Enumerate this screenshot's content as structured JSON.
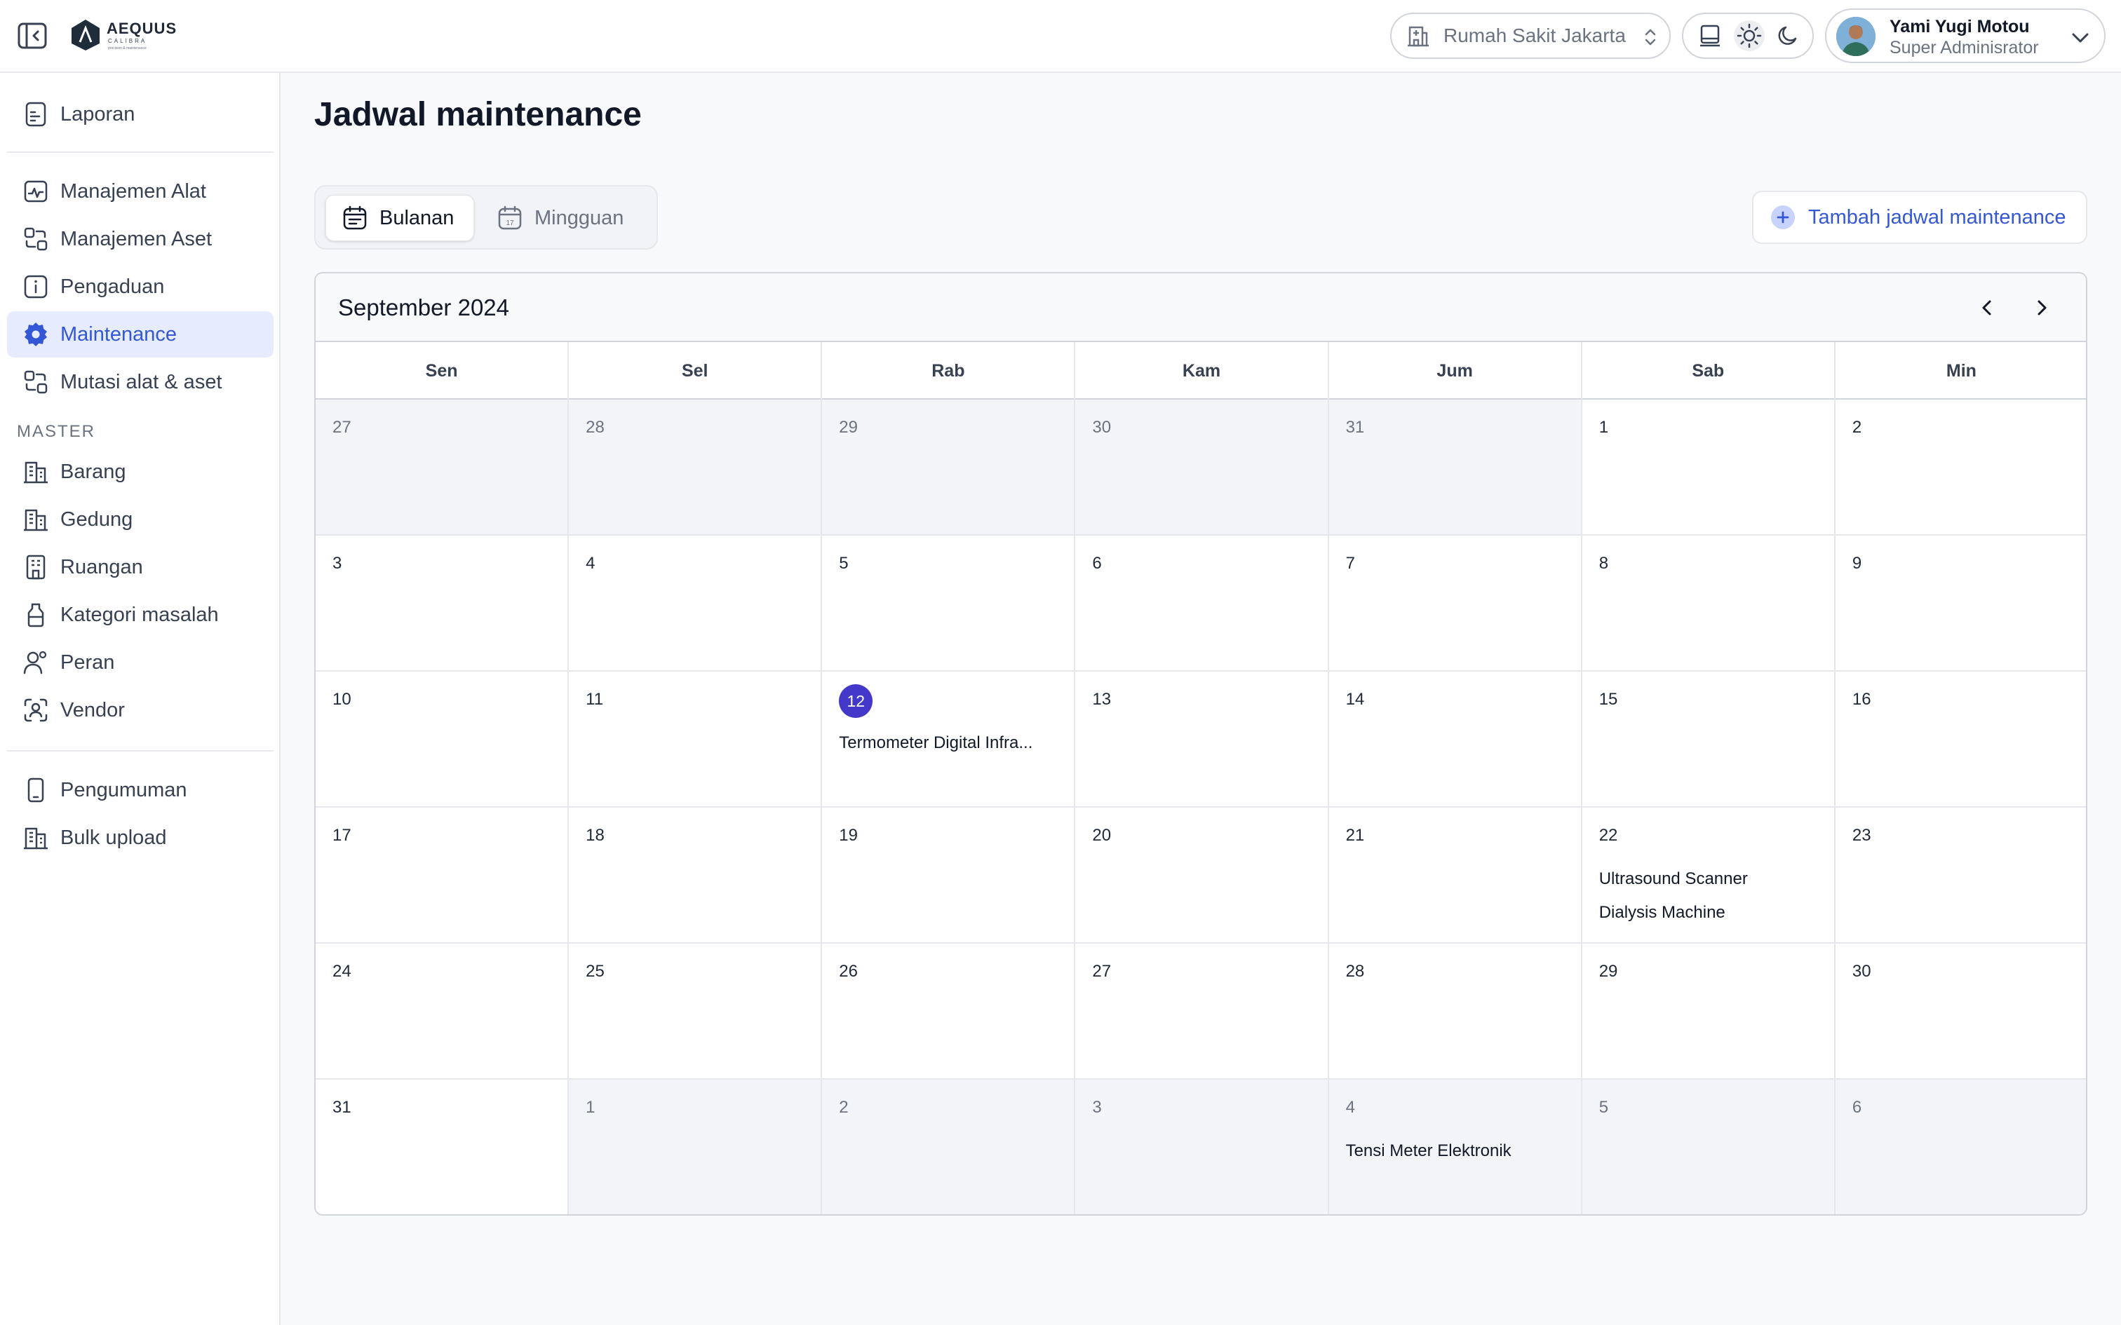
{
  "header": {
    "logo": {
      "name": "AEQUUS",
      "sub": "CALIBRA",
      "tag": "precision & maintenance"
    },
    "hospital_select": {
      "value": "Rumah Sakit Jakarta"
    },
    "user": {
      "name": "Yami Yugi Motou",
      "role": "Super Adminisrator"
    }
  },
  "sidebar": {
    "top_items": [
      {
        "label": "Laporan",
        "icon": "report-icon"
      }
    ],
    "main_items": [
      {
        "label": "Manajemen Alat",
        "icon": "monitor-icon"
      },
      {
        "label": "Manajemen Aset",
        "icon": "transfer-icon"
      },
      {
        "label": "Pengaduan",
        "icon": "info-icon"
      },
      {
        "label": "Maintenance",
        "icon": "gear-icon",
        "active": true
      },
      {
        "label": "Mutasi alat & aset",
        "icon": "transfer-icon"
      }
    ],
    "master_heading": "MASTER",
    "master_items": [
      {
        "label": "Barang",
        "icon": "building-icon"
      },
      {
        "label": "Gedung",
        "icon": "building-icon"
      },
      {
        "label": "Ruangan",
        "icon": "room-icon"
      },
      {
        "label": "Kategori masalah",
        "icon": "bottle-icon"
      },
      {
        "label": "Peran",
        "icon": "users-icon"
      },
      {
        "label": "Vendor",
        "icon": "scan-user-icon"
      }
    ],
    "bottom_items": [
      {
        "label": "Pengumuman",
        "icon": "phone-icon"
      },
      {
        "label": "Bulk upload",
        "icon": "building-icon"
      }
    ]
  },
  "page": {
    "title": "Jadwal maintenance",
    "tabs": [
      {
        "label": "Bulanan",
        "active": true
      },
      {
        "label": "Mingguan",
        "active": false
      }
    ],
    "add_button": "Tambah jadwal maintenance"
  },
  "calendar": {
    "month_label": "September 2024",
    "weekdays": [
      "Sen",
      "Sel",
      "Rab",
      "Kam",
      "Jum",
      "Sab",
      "Min"
    ],
    "weeks": [
      [
        {
          "day": "27",
          "outside": true,
          "events": []
        },
        {
          "day": "28",
          "outside": true,
          "events": []
        },
        {
          "day": "29",
          "outside": true,
          "events": []
        },
        {
          "day": "30",
          "outside": true,
          "events": []
        },
        {
          "day": "31",
          "outside": true,
          "events": []
        },
        {
          "day": "1",
          "outside": false,
          "events": []
        },
        {
          "day": "2",
          "outside": false,
          "events": []
        }
      ],
      [
        {
          "day": "3",
          "outside": false,
          "events": []
        },
        {
          "day": "4",
          "outside": false,
          "events": []
        },
        {
          "day": "5",
          "outside": false,
          "events": []
        },
        {
          "day": "6",
          "outside": false,
          "events": []
        },
        {
          "day": "7",
          "outside": false,
          "events": []
        },
        {
          "day": "8",
          "outside": false,
          "events": []
        },
        {
          "day": "9",
          "outside": false,
          "events": []
        }
      ],
      [
        {
          "day": "10",
          "outside": false,
          "events": []
        },
        {
          "day": "11",
          "outside": false,
          "events": []
        },
        {
          "day": "12",
          "outside": false,
          "today": true,
          "events": [
            "Termometer Digital Infra..."
          ]
        },
        {
          "day": "13",
          "outside": false,
          "events": []
        },
        {
          "day": "14",
          "outside": false,
          "events": []
        },
        {
          "day": "15",
          "outside": false,
          "events": []
        },
        {
          "day": "16",
          "outside": false,
          "events": []
        }
      ],
      [
        {
          "day": "17",
          "outside": false,
          "events": []
        },
        {
          "day": "18",
          "outside": false,
          "events": []
        },
        {
          "day": "19",
          "outside": false,
          "events": []
        },
        {
          "day": "20",
          "outside": false,
          "events": []
        },
        {
          "day": "21",
          "outside": false,
          "events": []
        },
        {
          "day": "22",
          "outside": false,
          "events": [
            "Ultrasound Scanner",
            "Dialysis Machine"
          ]
        },
        {
          "day": "23",
          "outside": false,
          "events": []
        }
      ],
      [
        {
          "day": "24",
          "outside": false,
          "events": []
        },
        {
          "day": "25",
          "outside": false,
          "events": []
        },
        {
          "day": "26",
          "outside": false,
          "events": []
        },
        {
          "day": "27",
          "outside": false,
          "events": []
        },
        {
          "day": "28",
          "outside": false,
          "events": []
        },
        {
          "day": "29",
          "outside": false,
          "events": []
        },
        {
          "day": "30",
          "outside": false,
          "events": []
        }
      ],
      [
        {
          "day": "31",
          "outside": false,
          "events": []
        },
        {
          "day": "1",
          "outside": true,
          "events": []
        },
        {
          "day": "2",
          "outside": true,
          "events": []
        },
        {
          "day": "3",
          "outside": true,
          "events": []
        },
        {
          "day": "4",
          "outside": true,
          "events": [
            "Tensi Meter Elektronik"
          ]
        },
        {
          "day": "5",
          "outside": true,
          "events": []
        },
        {
          "day": "6",
          "outside": true,
          "events": []
        }
      ]
    ]
  },
  "colors": {
    "accent": "#3457d5",
    "today_badge": "#4338ca",
    "active_nav_bg": "#e6ecfd"
  }
}
